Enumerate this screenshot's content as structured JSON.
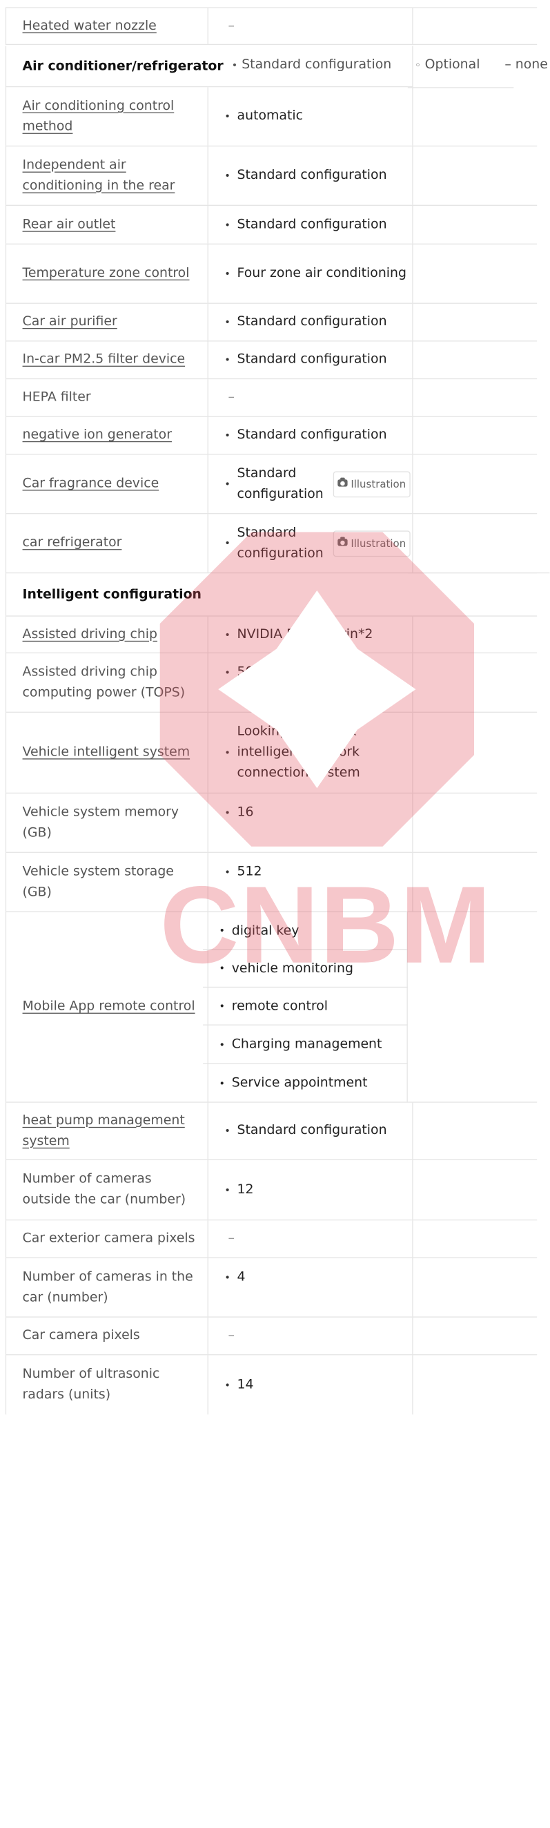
{
  "rows_top": [
    {
      "label": "Heated water nozzle",
      "link": true,
      "value": "–",
      "dash": true
    }
  ],
  "section_ac": {
    "title": "Air conditioner/refrigerator",
    "legend": {
      "standard": "Standard configuration",
      "optional": "Optional",
      "none": "none"
    }
  },
  "ac_rows": [
    {
      "label": "Air conditioning control method",
      "link": true,
      "value": "automatic"
    },
    {
      "label": "Independent air conditioning in the rear",
      "link": true,
      "value": "Standard configuration"
    },
    {
      "label": "Rear air outlet",
      "link": true,
      "value": "Standard configuration"
    },
    {
      "label": "Temperature zone control",
      "link": true,
      "value": "Four zone air conditioning"
    },
    {
      "label": "Car air purifier",
      "link": true,
      "value": "Standard configuration"
    },
    {
      "label": "In-car PM2.5 filter device",
      "link": true,
      "value": "Standard configuration"
    },
    {
      "label": "HEPA filter",
      "link": false,
      "value": "–",
      "dash": true
    },
    {
      "label": "negative ion generator",
      "link": true,
      "value": "Standard configuration"
    },
    {
      "label": "Car fragrance device",
      "link": true,
      "value": "Standard configuration",
      "illustration": "Illustration"
    },
    {
      "label": "car refrigerator",
      "link": true,
      "value": "Standard configuration",
      "illustration": "Illustration"
    }
  ],
  "section_intel": {
    "title": "Intelligent configuration"
  },
  "intel_rows": [
    {
      "label": "Assisted driving chip",
      "link": true,
      "value": "NVIDIA DRIVE Orin*2"
    },
    {
      "label": "Assisted driving chip computing power (TOPS)",
      "link": false,
      "value": "508"
    },
    {
      "label": "Vehicle intelligent system",
      "link": true,
      "value": "Looking up to Link intelligent network connection system"
    },
    {
      "label": "Vehicle system memory (GB)",
      "link": false,
      "value": "16"
    },
    {
      "label": "Vehicle system storage (GB)",
      "link": false,
      "value": "512"
    }
  ],
  "mobile_app": {
    "label": "Mobile App remote control",
    "values": [
      "digital key",
      "vehicle monitoring",
      "remote control",
      "Charging management",
      "Service appointment"
    ]
  },
  "intel_rows2": [
    {
      "label": "heat pump management system",
      "link": true,
      "value": "Standard configuration"
    },
    {
      "label": "Number of cameras outside the car (number)",
      "link": false,
      "value": "12"
    },
    {
      "label": "Car exterior camera pixels",
      "link": false,
      "value": "–",
      "dash": true
    },
    {
      "label": "Number of cameras in the car (number)",
      "link": false,
      "value": "4"
    },
    {
      "label": "Car camera pixels",
      "link": false,
      "value": "–",
      "dash": true
    },
    {
      "label": "Number of ultrasonic radars (units)",
      "link": false,
      "value": "14"
    }
  ],
  "watermark": {
    "text": "CNBM",
    "color": "#e2505c"
  }
}
